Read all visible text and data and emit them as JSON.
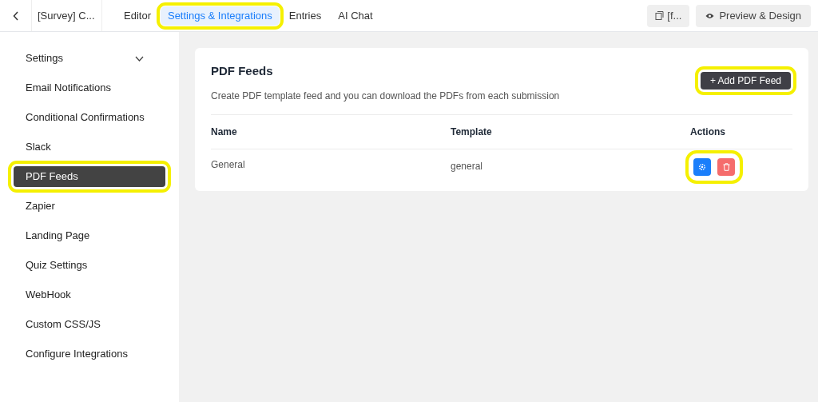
{
  "header": {
    "form_title": "[Survey] C...",
    "tabs": [
      {
        "label": "Editor",
        "selected": false,
        "highlighted": false
      },
      {
        "label": "Settings & Integrations",
        "selected": true,
        "highlighted": true
      },
      {
        "label": "Entries",
        "selected": false,
        "highlighted": false
      },
      {
        "label": "AI Chat",
        "selected": false,
        "highlighted": false
      }
    ],
    "shortcode_button": "[f...",
    "preview_button": "Preview & Design"
  },
  "sidebar": {
    "items": [
      {
        "label": "Settings",
        "kind": "group",
        "expanded": false,
        "selected": false,
        "highlighted": false
      },
      {
        "label": "Email Notifications",
        "kind": "item",
        "selected": false,
        "highlighted": false
      },
      {
        "label": "Conditional Confirmations",
        "kind": "item",
        "selected": false,
        "highlighted": false
      },
      {
        "label": "Slack",
        "kind": "item",
        "selected": false,
        "highlighted": false
      },
      {
        "label": "PDF Feeds",
        "kind": "item",
        "selected": true,
        "highlighted": true
      },
      {
        "label": "Zapier",
        "kind": "item",
        "selected": false,
        "highlighted": false
      },
      {
        "label": "Landing Page",
        "kind": "item",
        "selected": false,
        "highlighted": false
      },
      {
        "label": "Quiz Settings",
        "kind": "item",
        "selected": false,
        "highlighted": false
      },
      {
        "label": "WebHook",
        "kind": "item",
        "selected": false,
        "highlighted": false
      },
      {
        "label": "Custom CSS/JS",
        "kind": "item",
        "selected": false,
        "highlighted": false
      },
      {
        "label": "Configure Integrations",
        "kind": "item",
        "selected": false,
        "highlighted": false
      }
    ]
  },
  "panel": {
    "title": "PDF Feeds",
    "description": "Create PDF template feed and you can download the PDFs from each submission",
    "add_button": {
      "label": "+ Add PDF Feed",
      "highlighted": true
    },
    "table": {
      "columns": [
        "Name",
        "Template",
        "Actions"
      ],
      "rows": [
        {
          "name": "General",
          "template": "general",
          "actions_highlighted": true
        }
      ]
    }
  }
}
